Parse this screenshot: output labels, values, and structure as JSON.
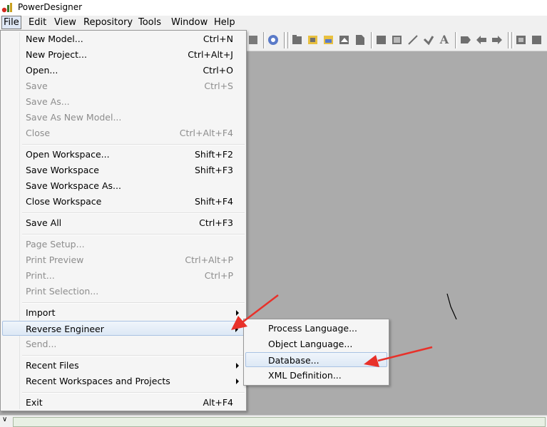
{
  "app": {
    "title": "PowerDesigner"
  },
  "menubar": {
    "items": [
      {
        "label": "File"
      },
      {
        "label": "Edit"
      },
      {
        "label": "View"
      },
      {
        "label": "Repository"
      },
      {
        "label": "Tools"
      },
      {
        "label": "Window"
      },
      {
        "label": "Help"
      }
    ]
  },
  "file_menu": {
    "items": [
      {
        "label": "New Model...",
        "shortcut": "Ctrl+N"
      },
      {
        "label": "New Project...",
        "shortcut": "Ctrl+Alt+J"
      },
      {
        "label": "Open...",
        "shortcut": "Ctrl+O"
      },
      {
        "label": "Save",
        "shortcut": "Ctrl+S"
      },
      {
        "label": "Save As..."
      },
      {
        "label": "Save As New Model..."
      },
      {
        "label": "Close",
        "shortcut": "Ctrl+Alt+F4"
      },
      {
        "label": "Open Workspace...",
        "shortcut": "Shift+F2"
      },
      {
        "label": "Save Workspace",
        "shortcut": "Shift+F3"
      },
      {
        "label": "Save Workspace As..."
      },
      {
        "label": "Close Workspace",
        "shortcut": "Shift+F4"
      },
      {
        "label": "Save All",
        "shortcut": "Ctrl+F3"
      },
      {
        "label": "Page Setup..."
      },
      {
        "label": "Print Preview",
        "shortcut": "Ctrl+Alt+P"
      },
      {
        "label": "Print...",
        "shortcut": "Ctrl+P"
      },
      {
        "label": "Print Selection..."
      },
      {
        "label": "Import"
      },
      {
        "label": "Reverse Engineer"
      },
      {
        "label": "Send..."
      },
      {
        "label": "Recent Files"
      },
      {
        "label": "Recent Workspaces and Projects"
      },
      {
        "label": "Exit",
        "shortcut": "Alt+F4"
      }
    ]
  },
  "reverse_engineer_submenu": {
    "items": [
      {
        "label": "Process Language..."
      },
      {
        "label": "Object Language..."
      },
      {
        "label": "Database..."
      },
      {
        "label": "XML Definition..."
      }
    ]
  },
  "colors": {
    "annotation_arrow": "#e8312a",
    "workspace": "#ababab",
    "menu_bg": "#f5f5f5",
    "disabled_text": "#8d8d8d"
  }
}
